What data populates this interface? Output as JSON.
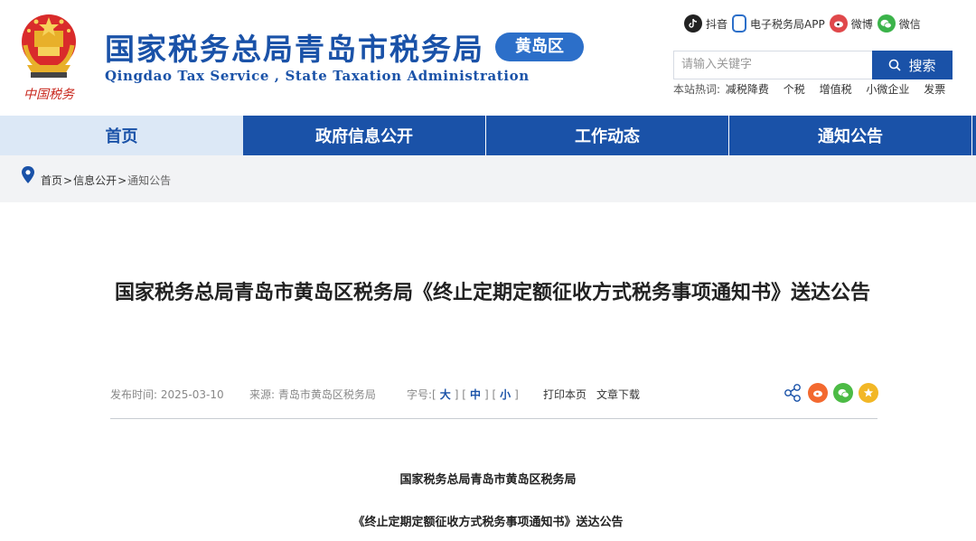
{
  "header": {
    "emblem_text": "中国税务",
    "title": "国家税务总局青岛市税务局",
    "subtitle": "Qingdao Tax Service , State Taxation Administration",
    "district": "黄岛区",
    "social": [
      {
        "label": "抖音",
        "icon": "douyin-icon"
      },
      {
        "label": "电子税务局APP",
        "icon": "phone-app-icon"
      },
      {
        "label": "微博",
        "icon": "weibo-icon"
      },
      {
        "label": "微信",
        "icon": "weixin-icon"
      }
    ],
    "search": {
      "placeholder": "请输入关键字",
      "button": "搜索"
    },
    "hotwords": {
      "label": "本站热词:",
      "items": [
        "减税降费",
        "个税",
        "增值税",
        "小微企业",
        "发票"
      ]
    }
  },
  "nav": {
    "items": [
      "首页",
      "政府信息公开",
      "工作动态",
      "通知公告"
    ],
    "active_index": 0
  },
  "breadcrumb": {
    "items": [
      "首页",
      "信息公开",
      "通知公告"
    ],
    "separator": ">"
  },
  "article": {
    "title": "国家税务总局青岛市黄岛区税务局《终止定期定额征收方式税务事项通知书》送达公告",
    "meta": {
      "date": "发布时间: 2025-03-10",
      "source": "来源: 青岛市黄岛区税务局",
      "font_size_label": "字号:",
      "font_sizes": [
        "大",
        "中",
        "小"
      ],
      "print": "打印本页",
      "download": "文章下载"
    },
    "body": [
      "国家税务总局青岛市黄岛区税务局",
      "《终止定期定额征收方式税务事项通知书》送达公告"
    ]
  },
  "colors": {
    "brand_blue": "#1a52a8",
    "badge_blue": "#2c6fc9",
    "nav_active_bg": "#dce8f6",
    "crumb_bg": "#f2f3f5"
  }
}
